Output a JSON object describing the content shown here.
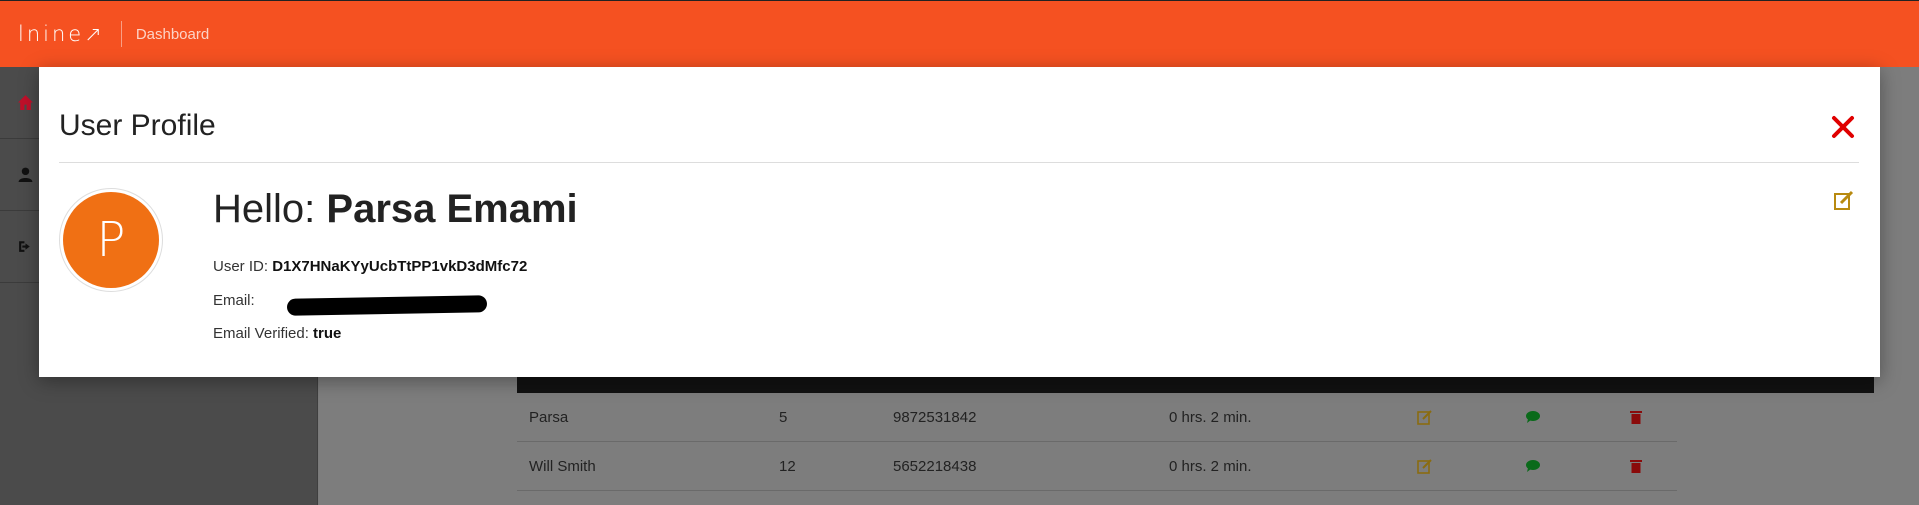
{
  "topbar": {
    "logo_text": "lnine↗",
    "breadcrumb": "Dashboard",
    "brand_color": "#f55121"
  },
  "sidebar": {
    "items": [
      {
        "icon": "home-icon"
      },
      {
        "icon": "user-icon"
      },
      {
        "icon": "sign-out-icon"
      }
    ]
  },
  "table": {
    "rows": [
      {
        "name": "Parsa",
        "count": "5",
        "phone": "9872531842",
        "duration": "0 hrs. 2 min."
      },
      {
        "name": "Will Smith",
        "count": "12",
        "phone": "5652218438",
        "duration": "0 hrs. 2 min."
      }
    ]
  },
  "modal": {
    "title": "User Profile",
    "avatar_letter": "P",
    "greeting_prefix": "Hello:",
    "user_name": "Parsa Emami",
    "user_id_label": "User ID:",
    "user_id_value": "D1X7HNaKYyUcbTtPP1vkD3dMfc72",
    "email_label": "Email:",
    "email_verified_label": "Email Verified:",
    "email_verified_value": "true",
    "close_color": "#e00000",
    "avatar_color": "#f07014"
  }
}
